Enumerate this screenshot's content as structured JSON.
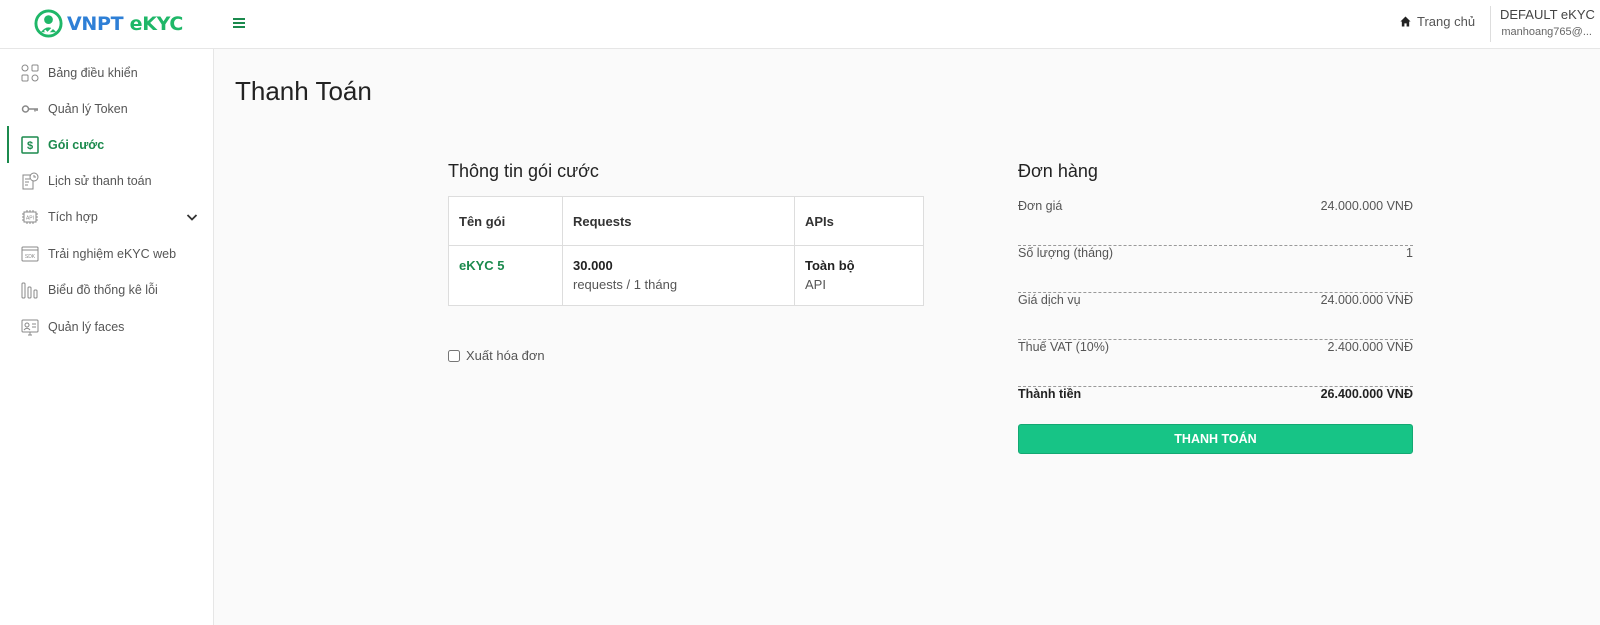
{
  "brand": {
    "part1": "VNPT",
    "part2": "eKYC"
  },
  "header": {
    "home_label": "Trang chủ",
    "user_name": "DEFAULT eKYC",
    "user_email": "manhoang765@..."
  },
  "sidebar": {
    "items": [
      {
        "label": "Bảng điều khiển",
        "icon": "dashboard-icon"
      },
      {
        "label": "Quản lý Token",
        "icon": "key-icon"
      },
      {
        "label": "Gói cước",
        "icon": "dollar-icon",
        "active": true
      },
      {
        "label": "Lịch sử thanh toán",
        "icon": "history-icon"
      },
      {
        "label": "Tích hợp",
        "icon": "api-icon",
        "has_submenu": true
      },
      {
        "label": "Trải nghiệm eKYC web",
        "icon": "sdk-icon"
      },
      {
        "label": "Biểu đồ thống kê lỗi",
        "icon": "bar-chart-icon"
      },
      {
        "label": "Quản lý faces",
        "icon": "face-id-icon"
      }
    ]
  },
  "page": {
    "title": "Thanh Toán"
  },
  "package": {
    "section_title": "Thông tin gói cước",
    "columns": [
      "Tên gói",
      "Requests",
      "APIs"
    ],
    "row": {
      "name": "eKYC 5",
      "requests_value": "30.000",
      "requests_unit": "requests / 1 tháng",
      "apis_value": "Toàn bộ",
      "apis_unit": "API"
    },
    "invoice_label": "Xuất hóa đơn",
    "invoice_checked": false
  },
  "order": {
    "section_title": "Đơn hàng",
    "rows": [
      {
        "label": "Đơn giá",
        "value": "24.000.000 VNĐ"
      },
      {
        "label": "Số lượng (tháng)",
        "value": "1"
      },
      {
        "label": "Giá dịch vụ",
        "value": "24.000.000 VNĐ"
      },
      {
        "label": "Thuế VAT (10%)",
        "value": "2.400.000 VNĐ"
      }
    ],
    "total": {
      "label": "Thành tiền",
      "value": "26.400.000 VNĐ"
    },
    "pay_button": "THANH TOÁN"
  },
  "colors": {
    "accent": "#1b8a4d",
    "button": "#17c486",
    "brand_blue": "#2e7fd6",
    "brand_green": "#1fb768"
  }
}
